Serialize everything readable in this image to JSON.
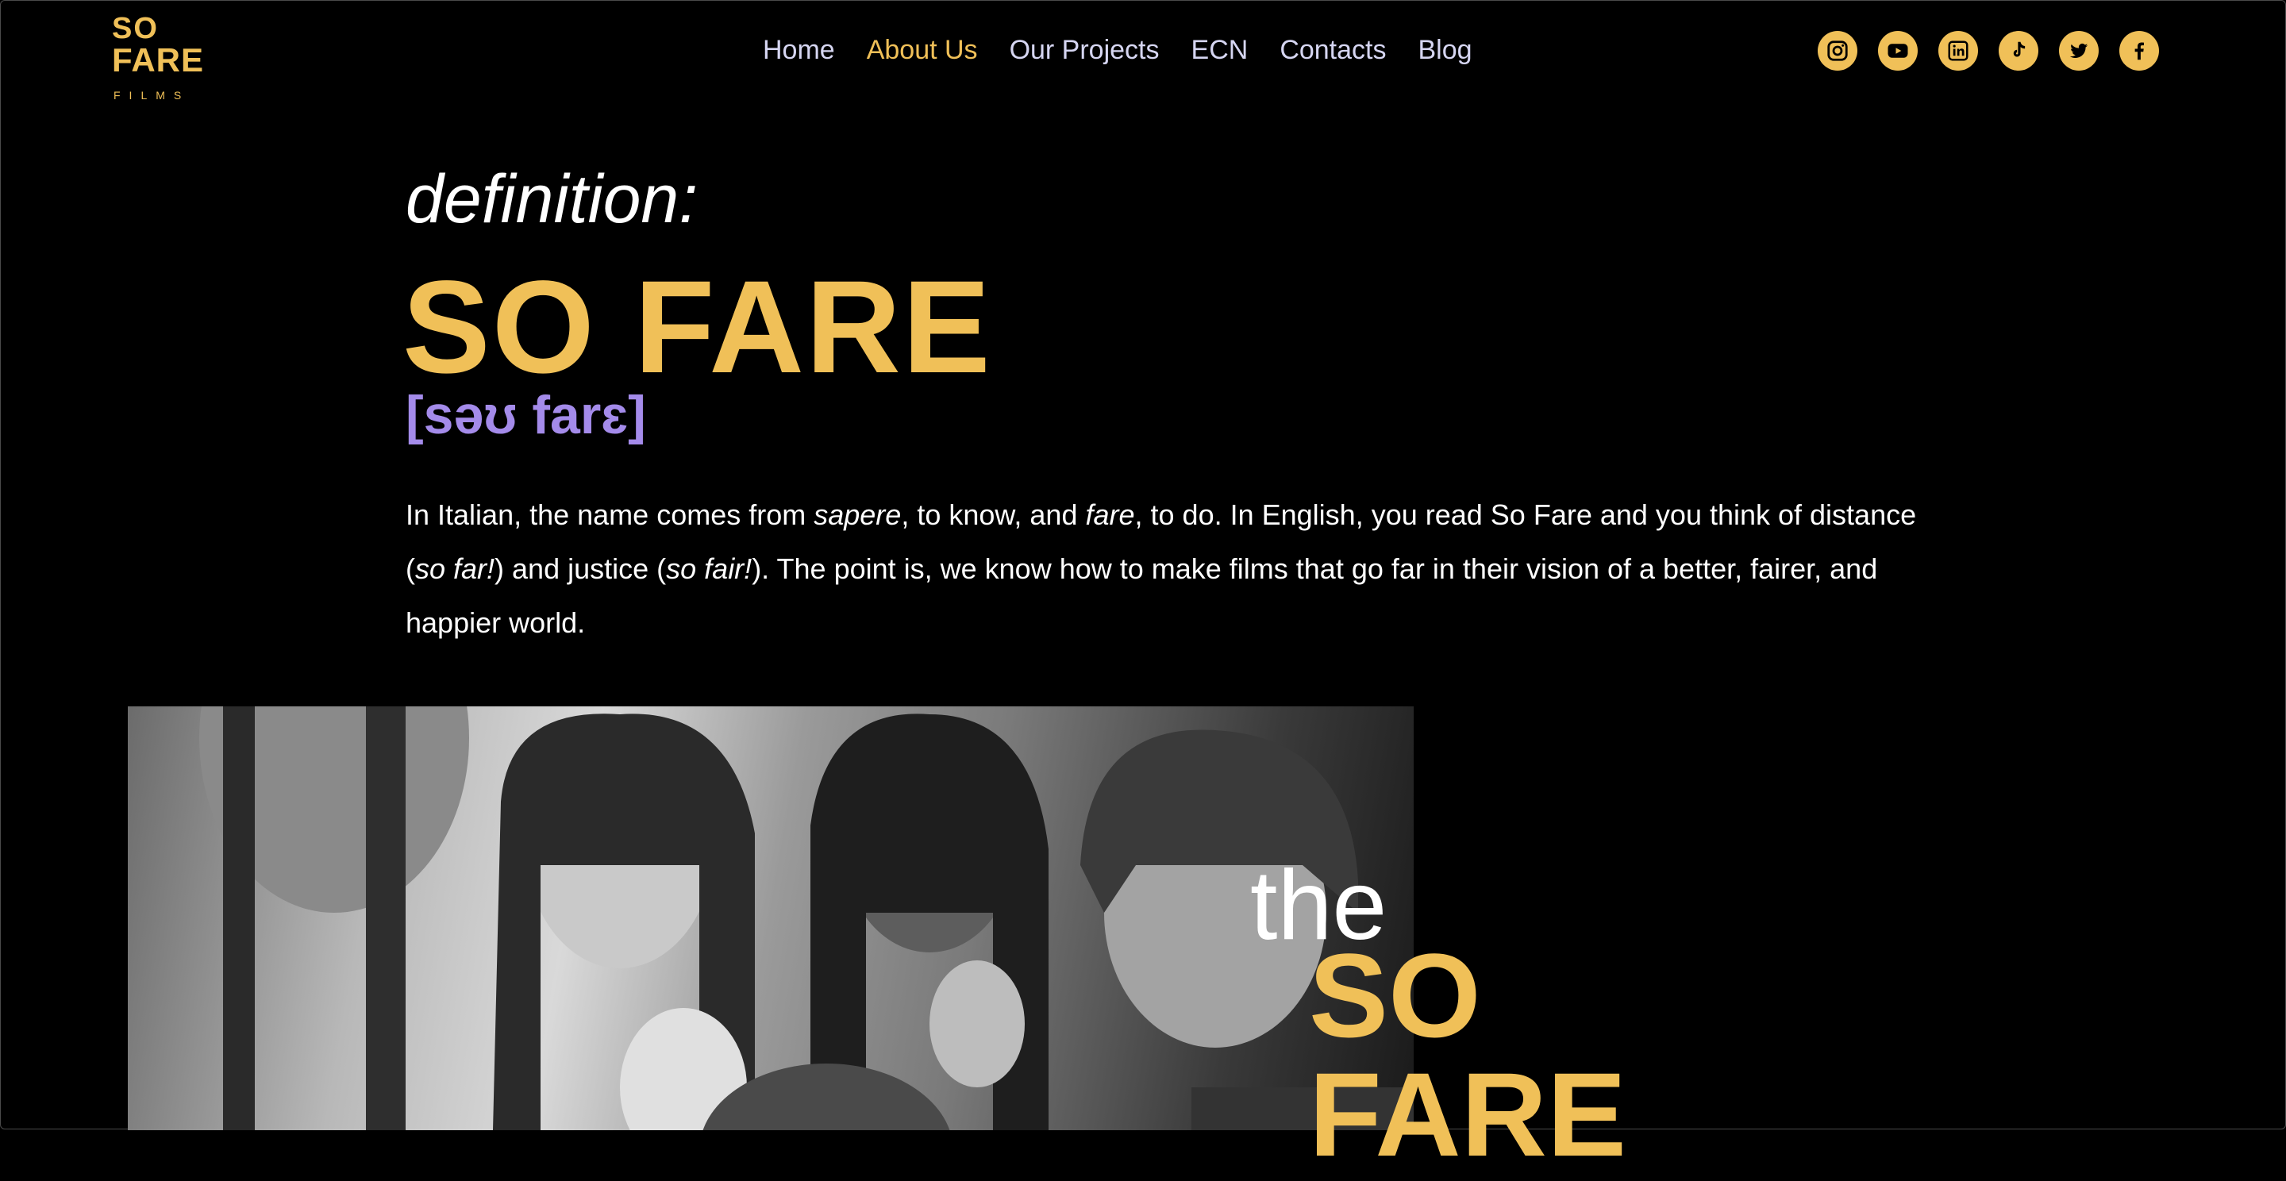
{
  "logo": {
    "line1": "SO",
    "line2": "FARE",
    "line3": "FILMS"
  },
  "nav": [
    {
      "label": "Home",
      "active": false
    },
    {
      "label": "About Us",
      "active": true
    },
    {
      "label": "Our Projects",
      "active": false
    },
    {
      "label": "ECN",
      "active": false
    },
    {
      "label": "Contacts",
      "active": false
    },
    {
      "label": "Blog",
      "active": false
    }
  ],
  "social": [
    "instagram-icon",
    "youtube-icon",
    "linkedin-icon",
    "tiktok-icon",
    "twitter-icon",
    "facebook-icon"
  ],
  "definition": {
    "label": "definition:",
    "title": "SO FARE",
    "phonetic": "[səʊ farɛ]",
    "paragraph": {
      "p1": "In Italian, the name comes from ",
      "sapere": "sapere",
      "p2": ", to know, and ",
      "fare": "fare",
      "p3": ", to do. In English, you read So Fare and you think of distance (",
      "so_far": "so far!",
      "p4": ") and justice (",
      "so_fair": "so fair!",
      "p5": "). The point is, we know how to make films that go far in their vision of a better, fairer, and happier world."
    }
  },
  "hero": {
    "the": "the",
    "so": "SO",
    "fare": "FARE"
  },
  "colors": {
    "accent": "#f0c058",
    "phonetic": "#a48bea",
    "nav_text": "#d6d6f2",
    "background": "#000000"
  }
}
